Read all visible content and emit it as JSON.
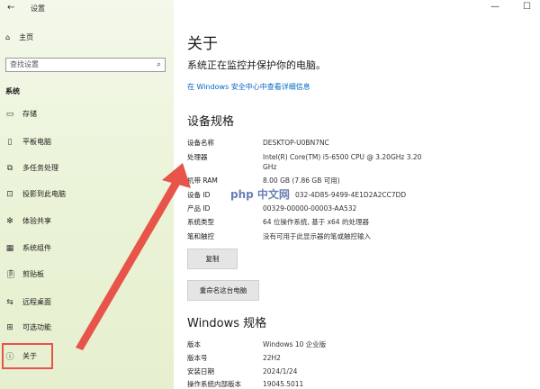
{
  "window": {
    "title": "设置",
    "minimize": "—",
    "maximize": "☐"
  },
  "sidebar": {
    "home": "主页",
    "search_placeholder": "查找设置",
    "section": "系统",
    "items": [
      {
        "label": "存储",
        "icon": "storage-icon"
      },
      {
        "label": "平板电脑",
        "icon": "tablet-icon"
      },
      {
        "label": "多任务处理",
        "icon": "multitasking-icon"
      },
      {
        "label": "投影到此电脑",
        "icon": "projecting-icon"
      },
      {
        "label": "体验共享",
        "icon": "shared-experiences-icon"
      },
      {
        "label": "系统组件",
        "icon": "system-components-icon"
      },
      {
        "label": "剪贴板",
        "icon": "clipboard-icon"
      },
      {
        "label": "远程桌面",
        "icon": "remote-desktop-icon"
      },
      {
        "label": "可选功能",
        "icon": "optional-features-icon"
      },
      {
        "label": "关于",
        "icon": "info-icon",
        "active": true
      }
    ]
  },
  "main": {
    "title": "关于",
    "protect_text": "系统正在监控并保护你的电脑。",
    "security_link": "在 Windows 安全中心中查看详细信息",
    "device_specs": {
      "heading": "设备规格",
      "rows": [
        {
          "k": "设备名称",
          "v": "DESKTOP-U0BN7NC"
        },
        {
          "k": "处理器",
          "v": "Intel(R) Core(TM) i5-6500 CPU @ 3.20GHz   3.20 GHz"
        },
        {
          "k": "机带 RAM",
          "v": "8.00 GB (7.86 GB 可用)"
        },
        {
          "k": "设备 ID",
          "v": "032-4D85-9499-4E1D2A2CC7DD"
        },
        {
          "k": "产品 ID",
          "v": "00329-00000-00003-AA532"
        },
        {
          "k": "系统类型",
          "v": "64 位操作系统, 基于 x64 的处理器"
        },
        {
          "k": "笔和触控",
          "v": "没有可用于此显示器的笔或触控输入"
        }
      ],
      "copy_button": "复制",
      "rename_button": "重命名这台电脑"
    },
    "windows_specs": {
      "heading": "Windows 规格",
      "rows": [
        {
          "k": "版本",
          "v": "Windows 10 企业版"
        },
        {
          "k": "版本号",
          "v": "22H2"
        },
        {
          "k": "安装日期",
          "v": "2024/1/24"
        },
        {
          "k": "操作系统内部版本",
          "v": "19045.5011"
        }
      ]
    },
    "watermark": "php 中文网"
  },
  "colors": {
    "highlight": "#e8534a",
    "link": "#0067c0"
  }
}
